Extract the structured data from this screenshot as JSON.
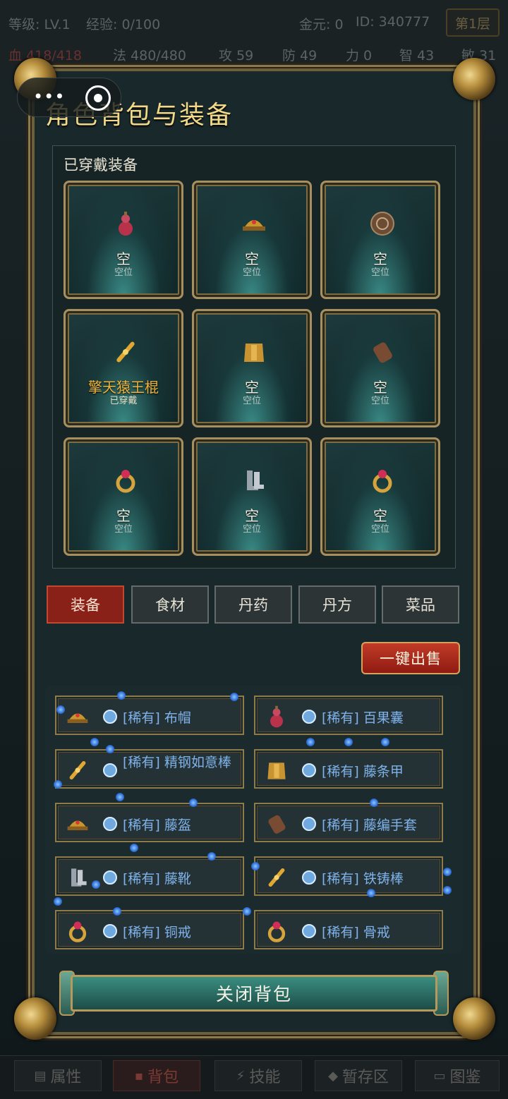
{
  "topbar": {
    "level": "等级: LV.1",
    "exp": "经验: 0/100",
    "gold": "金元: 0",
    "id": "ID: 340777",
    "floor": "第1层",
    "hp": "血 418/418",
    "mp": "法 480/480",
    "atk": "攻 59",
    "def": "防 49",
    "str": "力 0",
    "int": "智 43",
    "agi": "敏 31"
  },
  "capsule": {
    "more": "•••"
  },
  "panel": {
    "title": "角色背包与装备"
  },
  "equipped": {
    "title": "已穿戴装备",
    "slots": [
      {
        "name": "空",
        "status": "空位",
        "icon": "gourd-icon"
      },
      {
        "name": "空",
        "status": "空位",
        "icon": "helmet-icon"
      },
      {
        "name": "空",
        "status": "空位",
        "icon": "shield-icon"
      },
      {
        "name": "擎天猿王棍",
        "status": "已穿戴",
        "icon": "staff-icon"
      },
      {
        "name": "空",
        "status": "空位",
        "icon": "armor-icon"
      },
      {
        "name": "空",
        "status": "空位",
        "icon": "gauntlet-icon"
      },
      {
        "name": "空",
        "status": "空位",
        "icon": "ring-icon"
      },
      {
        "name": "空",
        "status": "空位",
        "icon": "boots-icon"
      },
      {
        "name": "空",
        "status": "空位",
        "icon": "ring-icon"
      }
    ]
  },
  "tabs": [
    {
      "label": "装备",
      "active": true
    },
    {
      "label": "食材",
      "active": false
    },
    {
      "label": "丹药",
      "active": false
    },
    {
      "label": "丹方",
      "active": false
    },
    {
      "label": "菜品",
      "active": false
    }
  ],
  "sell_all": "一键出售",
  "inventory": [
    {
      "label": "[稀有] 布帽",
      "icon": "helmet-icon"
    },
    {
      "label": "[稀有] 百果囊",
      "icon": "gourd-icon"
    },
    {
      "label": "[稀有] 精钢如意棒",
      "icon": "staff-icon"
    },
    {
      "label": "[稀有] 藤条甲",
      "icon": "armor-icon"
    },
    {
      "label": "[稀有] 藤盔",
      "icon": "helmet-icon"
    },
    {
      "label": "[稀有] 藤编手套",
      "icon": "gauntlet-icon"
    },
    {
      "label": "[稀有] 藤靴",
      "icon": "boots-icon"
    },
    {
      "label": "[稀有] 铁铸棒",
      "icon": "staff-icon"
    },
    {
      "label": "[稀有] 铜戒",
      "icon": "ring-icon"
    },
    {
      "label": "[稀有] 骨戒",
      "icon": "ring-icon"
    }
  ],
  "close_button": "关闭背包",
  "bottom_nav": [
    {
      "label": "属性",
      "icon": "stats-icon"
    },
    {
      "label": "背包",
      "icon": "bag-icon",
      "active": true
    },
    {
      "label": "技能",
      "icon": "lightning-icon"
    },
    {
      "label": "暂存区",
      "icon": "storage-icon"
    },
    {
      "label": "图鉴",
      "icon": "book-icon"
    }
  ],
  "colors": {
    "gold": "#f2d98a",
    "rare_text": "#7fb2ea",
    "active_tab": "#8a2118",
    "worn_name": "#f0b33a"
  }
}
